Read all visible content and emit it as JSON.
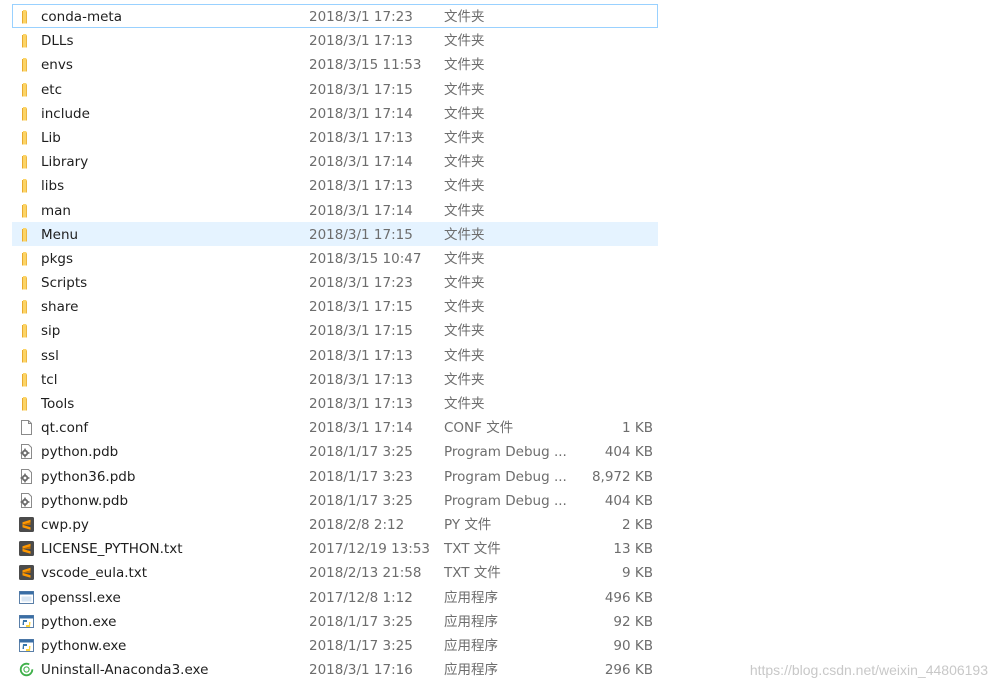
{
  "files": [
    {
      "name": "conda-meta",
      "date": "2018/3/1 17:23",
      "type": "文件夹",
      "size": "",
      "icon": "folder-icon",
      "state": "focused"
    },
    {
      "name": "DLLs",
      "date": "2018/3/1 17:13",
      "type": "文件夹",
      "size": "",
      "icon": "folder-icon"
    },
    {
      "name": "envs",
      "date": "2018/3/15 11:53",
      "type": "文件夹",
      "size": "",
      "icon": "folder-icon"
    },
    {
      "name": "etc",
      "date": "2018/3/1 17:15",
      "type": "文件夹",
      "size": "",
      "icon": "folder-icon"
    },
    {
      "name": "include",
      "date": "2018/3/1 17:14",
      "type": "文件夹",
      "size": "",
      "icon": "folder-icon"
    },
    {
      "name": "Lib",
      "date": "2018/3/1 17:13",
      "type": "文件夹",
      "size": "",
      "icon": "folder-icon"
    },
    {
      "name": "Library",
      "date": "2018/3/1 17:14",
      "type": "文件夹",
      "size": "",
      "icon": "folder-icon"
    },
    {
      "name": "libs",
      "date": "2018/3/1 17:13",
      "type": "文件夹",
      "size": "",
      "icon": "folder-icon"
    },
    {
      "name": "man",
      "date": "2018/3/1 17:14",
      "type": "文件夹",
      "size": "",
      "icon": "folder-icon"
    },
    {
      "name": "Menu",
      "date": "2018/3/1 17:15",
      "type": "文件夹",
      "size": "",
      "icon": "folder-icon",
      "state": "hovered"
    },
    {
      "name": "pkgs",
      "date": "2018/3/15 10:47",
      "type": "文件夹",
      "size": "",
      "icon": "folder-icon"
    },
    {
      "name": "Scripts",
      "date": "2018/3/1 17:23",
      "type": "文件夹",
      "size": "",
      "icon": "folder-icon"
    },
    {
      "name": "share",
      "date": "2018/3/1 17:15",
      "type": "文件夹",
      "size": "",
      "icon": "folder-icon"
    },
    {
      "name": "sip",
      "date": "2018/3/1 17:15",
      "type": "文件夹",
      "size": "",
      "icon": "folder-icon"
    },
    {
      "name": "ssl",
      "date": "2018/3/1 17:13",
      "type": "文件夹",
      "size": "",
      "icon": "folder-icon"
    },
    {
      "name": "tcl",
      "date": "2018/3/1 17:13",
      "type": "文件夹",
      "size": "",
      "icon": "folder-icon"
    },
    {
      "name": "Tools",
      "date": "2018/3/1 17:13",
      "type": "文件夹",
      "size": "",
      "icon": "folder-icon"
    },
    {
      "name": "qt.conf",
      "date": "2018/3/1 17:14",
      "type": "CONF 文件",
      "size": "1 KB",
      "icon": "blank-file-icon"
    },
    {
      "name": "python.pdb",
      "date": "2018/1/17 3:25",
      "type": "Program Debug ...",
      "size": "404 KB",
      "icon": "debug-file-icon"
    },
    {
      "name": "python36.pdb",
      "date": "2018/1/17 3:23",
      "type": "Program Debug ...",
      "size": "8,972 KB",
      "icon": "debug-file-icon"
    },
    {
      "name": "pythonw.pdb",
      "date": "2018/1/17 3:25",
      "type": "Program Debug ...",
      "size": "404 KB",
      "icon": "debug-file-icon"
    },
    {
      "name": "cwp.py",
      "date": "2018/2/8 2:12",
      "type": "PY 文件",
      "size": "2 KB",
      "icon": "sublime-file-icon"
    },
    {
      "name": "LICENSE_PYTHON.txt",
      "date": "2017/12/19 13:53",
      "type": "TXT 文件",
      "size": "13 KB",
      "icon": "sublime-file-icon"
    },
    {
      "name": "vscode_eula.txt",
      "date": "2018/2/13 21:58",
      "type": "TXT 文件",
      "size": "9 KB",
      "icon": "sublime-file-icon"
    },
    {
      "name": "openssl.exe",
      "date": "2017/12/8 1:12",
      "type": "应用程序",
      "size": "496 KB",
      "icon": "exe-app-icon"
    },
    {
      "name": "python.exe",
      "date": "2018/1/17 3:25",
      "type": "应用程序",
      "size": "92 KB",
      "icon": "python-exe-icon"
    },
    {
      "name": "pythonw.exe",
      "date": "2018/1/17 3:25",
      "type": "应用程序",
      "size": "90 KB",
      "icon": "python-exe-icon"
    },
    {
      "name": "Uninstall-Anaconda3.exe",
      "date": "2018/3/1 17:16",
      "type": "应用程序",
      "size": "296 KB",
      "icon": "anaconda-icon"
    }
  ],
  "watermark": "https://blog.csdn.net/weixin_44806193"
}
